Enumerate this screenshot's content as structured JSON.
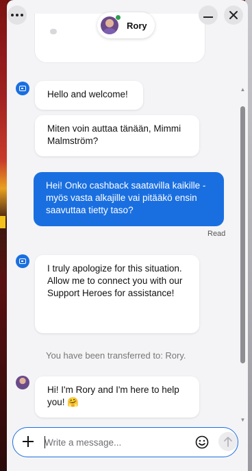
{
  "header": {
    "agent_name": "Rory",
    "icons": {
      "menu": "more-horizontal-icon",
      "minimize": "minimize-icon",
      "close": "close-icon"
    }
  },
  "messages": {
    "bot_greeting": "Hello and welcome!",
    "bot_question": "Miten voin auttaa tänään, Mimmi Malmström?",
    "user_message": "Hei! Onko cashback saatavilla kaikille - myös vasta alkajille vai pitääkö ensin saavuttaa tietty taso?",
    "read_status": "Read",
    "bot_apology": "I truly apologize for this situation.\nAllow me to connect you with our Support Heroes for assistance!",
    "system_transfer": "You have been transferred to: Rory.",
    "agent_greeting": "Hi! I'm Rory and I'm here to help you! 🤗"
  },
  "composer": {
    "placeholder": "Write a message...",
    "value": ""
  },
  "colors": {
    "accent": "#1a6fe0",
    "panel": "#f4f4f6",
    "online": "#2e9e4f"
  }
}
